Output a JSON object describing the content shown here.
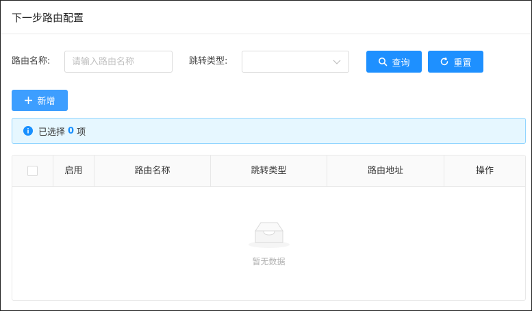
{
  "header": {
    "title": "下一步路由配置"
  },
  "filters": {
    "route_name_label": "路由名称:",
    "route_name_placeholder": "请输入路由名称",
    "jump_type_label": "跳转类型:",
    "jump_type_value": "",
    "query_label": "查询",
    "reset_label": "重置"
  },
  "toolbar": {
    "add_label": "新增"
  },
  "alert": {
    "prefix": "已选择",
    "count": "0",
    "suffix": "项"
  },
  "table": {
    "columns": [
      "启用",
      "路由名称",
      "跳转类型",
      "路由地址",
      "操作"
    ],
    "rows": [],
    "empty_text": "暂无数据"
  },
  "colors": {
    "primary": "#1e90ff",
    "alert_bg": "#e6f7ff",
    "alert_border": "#91d5ff"
  }
}
